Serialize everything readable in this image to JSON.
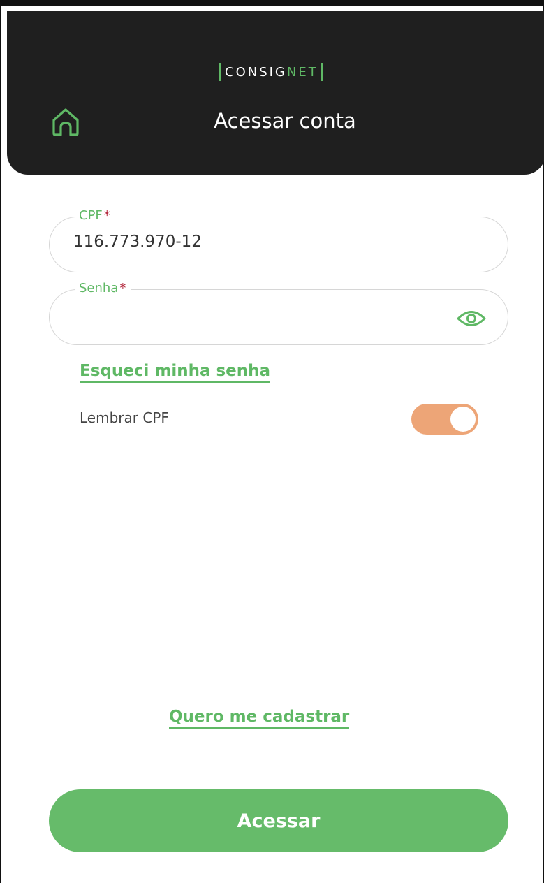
{
  "app": {
    "logo_text_part1": "CONSIG",
    "logo_text_part2": "NET",
    "brand_color": "#5fb865"
  },
  "header": {
    "title": "Acessar conta",
    "home_icon": "home-icon"
  },
  "form": {
    "cpf": {
      "label": "CPF",
      "required_mark": "*",
      "value": "116.773.970-12"
    },
    "senha": {
      "label": "Senha",
      "required_mark": "*",
      "value": "",
      "toggle_icon": "eye-icon"
    },
    "forgot_password": "Esqueci minha senha",
    "remember": {
      "label": "Lembrar CPF",
      "enabled": true,
      "color": "#eda577"
    },
    "register_link": "Quero me cadastrar",
    "submit_label": "Acessar",
    "submit_color": "#66bb6a"
  }
}
